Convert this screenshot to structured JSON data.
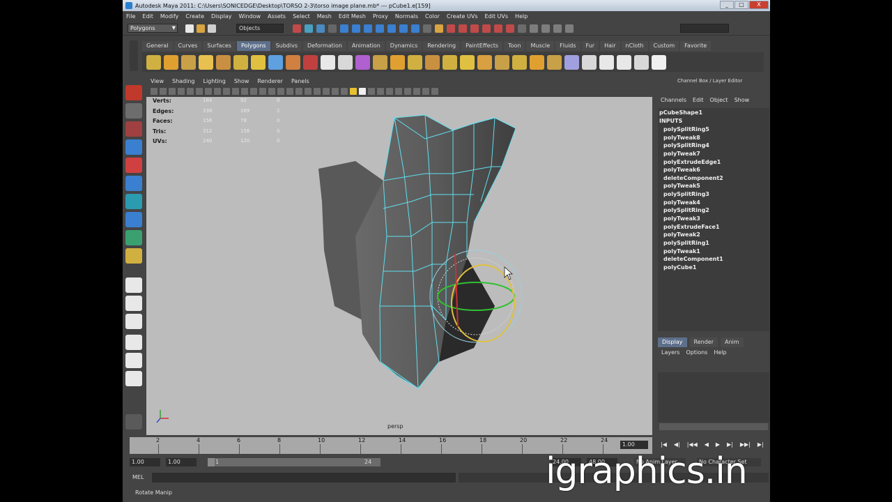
{
  "window": {
    "title": "Autodesk Maya 2011: C:\\Users\\SONICEDGE\\Desktop\\TORSO 2-3\\torso image plane.mb*   ---   pCube1.e[159]",
    "buttons": [
      "_",
      "□",
      "X"
    ]
  },
  "menubar": [
    "File",
    "Edit",
    "Modify",
    "Create",
    "Display",
    "Window",
    "Assets",
    "Select",
    "Mesh",
    "Edit Mesh",
    "Proxy",
    "Normals",
    "Color",
    "Create UVs",
    "Edit UVs",
    "Help"
  ],
  "statusline": {
    "mode": "Polygons",
    "selection_field": "Objects"
  },
  "shelf": {
    "tabs": [
      "General",
      "Curves",
      "Surfaces",
      "Polygons",
      "Subdivs",
      "Deformation",
      "Animation",
      "Dynamics",
      "Rendering",
      "PaintEffects",
      "Toon",
      "Muscle",
      "Fluids",
      "Fur",
      "Hair",
      "nCloth",
      "Custom",
      "Favorite"
    ],
    "active_tab": "Polygons",
    "icon_count": 30
  },
  "viewport": {
    "menus": [
      "View",
      "Shading",
      "Lighting",
      "Show",
      "Renderer",
      "Panels"
    ],
    "hud": [
      {
        "label": "Verts:",
        "values": [
          "184",
          "92",
          "0"
        ]
      },
      {
        "label": "Edges:",
        "values": [
          "338",
          "169",
          "2"
        ]
      },
      {
        "label": "Faces:",
        "values": [
          "156",
          "78",
          "0"
        ]
      },
      {
        "label": "Tris:",
        "values": [
          "312",
          "156",
          "0"
        ]
      },
      {
        "label": "UVs:",
        "values": [
          "240",
          "120",
          "0"
        ]
      }
    ],
    "camera": "persp",
    "background": "#bcbcbc",
    "wire_color": "#5fe0f0"
  },
  "channel_box": {
    "title": "Channel Box / Layer Editor",
    "menus": [
      "Channels",
      "Edit",
      "Object",
      "Show"
    ],
    "shape": "pCubeShape1",
    "inputs_label": "INPUTS",
    "inputs": [
      "polySplitRing5",
      "polyTweak8",
      "polySplitRing4",
      "polyTweak7",
      "polyExtrudeEdge1",
      "polyTweak6",
      "deleteComponent2",
      "polyTweak5",
      "polySplitRing3",
      "polyTweak4",
      "polySplitRing2",
      "polyTweak3",
      "polyExtrudeFace1",
      "polyTweak2",
      "polySplitRing1",
      "polyTweak1",
      "deleteComponent1",
      "polyCube1"
    ]
  },
  "layer_editor": {
    "tabs": [
      "Display",
      "Render",
      "Anim"
    ],
    "active_tab": "Display",
    "menus": [
      "Layers",
      "Options",
      "Help"
    ]
  },
  "timeslider": {
    "ticks": [
      "2",
      "4",
      "6",
      "8",
      "10",
      "12",
      "14",
      "16",
      "18",
      "20",
      "22",
      "24"
    ],
    "current_frame": "1.00",
    "playback_buttons": [
      "|◀",
      "◀|",
      "|◀◀",
      "◀",
      "▶",
      "▶|",
      "▶▶|",
      "▶|"
    ]
  },
  "range": {
    "start": "1.00",
    "anim_start": "1.00",
    "range_start": "1",
    "range_end": "24",
    "anim_end": "24.00",
    "end": "48.00",
    "anim_layer": "No Anim Layer",
    "character_set": "No Character Set"
  },
  "command_line": {
    "label": "MEL"
  },
  "help_line": "Rotate Manip",
  "watermark": "igraphics.in"
}
